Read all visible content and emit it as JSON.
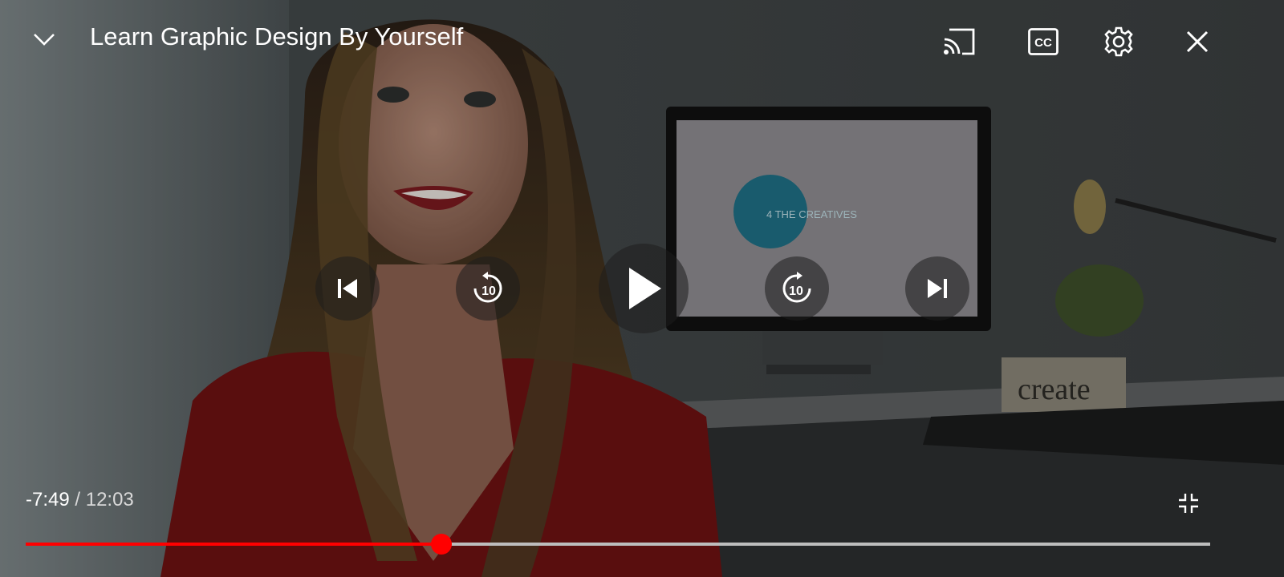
{
  "video": {
    "title": "Learn Graphic Design By Yourself",
    "remaining_time": "-7:49",
    "separator": "/",
    "total_time": "12:03",
    "progress_fraction": 0.351
  },
  "controls": {
    "top": [
      "chevron-down-icon",
      "cast-icon",
      "closed-captions-icon",
      "gear-icon",
      "close-icon"
    ],
    "center": [
      "skip-previous-icon",
      "rewind-10-icon",
      "play-icon",
      "forward-10-icon",
      "skip-next-icon"
    ],
    "rewind_seconds": "10",
    "forward_seconds": "10",
    "cc_label": "CC"
  },
  "scene": {
    "sign_text": "create",
    "logo_text": "4 THE CREATIVES"
  },
  "colors": {
    "progress_played": "#ff0000",
    "progress_track": "#bdbdbd",
    "text": "#ffffff"
  }
}
